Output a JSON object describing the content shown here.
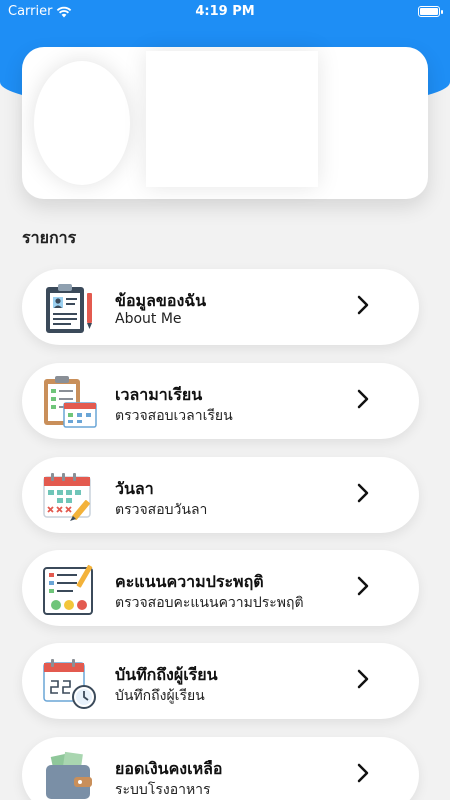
{
  "status_bar": {
    "carrier": "Carrier",
    "time": "4:19 PM"
  },
  "section": {
    "title": "รายการ"
  },
  "menu": [
    {
      "title": "ข้อมูลของฉัน",
      "subtitle": "About Me",
      "icon": "id-card-clipboard-icon"
    },
    {
      "title": "เวลามาเรียน",
      "subtitle": "ตรวจสอบเวลาเรียน",
      "icon": "attendance-clipboard-icon"
    },
    {
      "title": "วันลา",
      "subtitle": "ตรวจสอบวันลา",
      "icon": "calendar-pencil-icon"
    },
    {
      "title": "คะแนนความประพฤติ",
      "subtitle": "ตรวจสอบคะแนนความประพฤติ",
      "icon": "behavior-score-icon"
    },
    {
      "title": "บันทึกถึงผู้เรียน",
      "subtitle": "บันทึกถึงผู้เรียน",
      "icon": "calendar-clock-icon"
    },
    {
      "title": "ยอดเงินคงเหลือ",
      "subtitle": "ระบบโรงอาหาร",
      "icon": "wallet-icon"
    }
  ],
  "colors": {
    "header_blue": "#1e8ef5",
    "background": "#f2f2f2"
  }
}
